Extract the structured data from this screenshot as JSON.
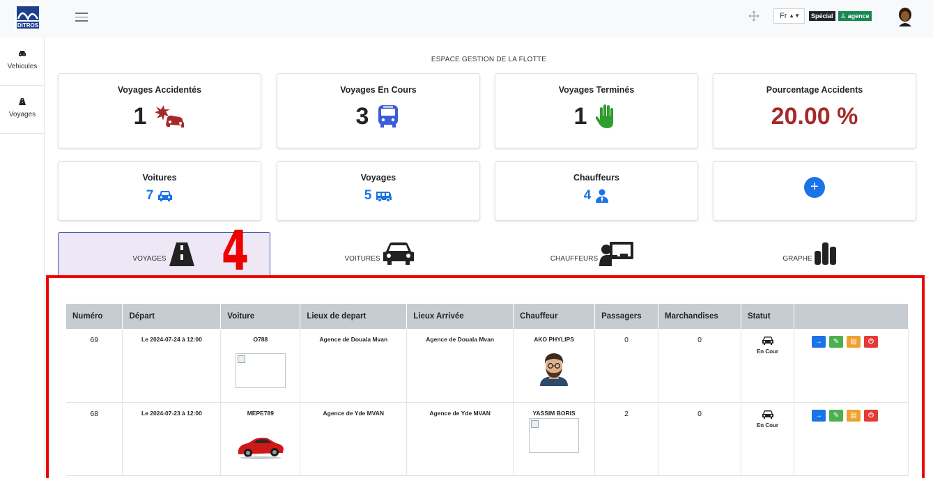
{
  "header": {
    "logo_text": "DITROS",
    "lang": "Fr",
    "badge_special": "Spécial",
    "badge_agence": "agence"
  },
  "sidebar": {
    "items": [
      {
        "label": "Vehicules",
        "icon": "car-icon"
      },
      {
        "label": "Voyages",
        "icon": "road-icon"
      }
    ]
  },
  "main": {
    "title": "ESPACE GESTION DE LA FLOTTE",
    "stats_top": [
      {
        "title": "Voyages Accidentés",
        "value": "1",
        "icon": "car-crash-icon",
        "color": "#a52a2a"
      },
      {
        "title": "Voyages En Cours",
        "value": "3",
        "icon": "bus-icon",
        "color": "#3b5bdb"
      },
      {
        "title": "Voyages Terminés",
        "value": "1",
        "icon": "hand-stop-icon",
        "color": "#2e9e2e"
      },
      {
        "title": "Pourcentage Accidents",
        "value": "20.00 %"
      }
    ],
    "stats_bottom": [
      {
        "title": "Voitures",
        "value": "7",
        "icon": "car-icon"
      },
      {
        "title": "Voyages",
        "value": "5",
        "icon": "shuttle-van-icon"
      },
      {
        "title": "Chauffeurs",
        "value": "4",
        "icon": "user-tie-icon"
      },
      {
        "title": "",
        "value": "+",
        "icon": "plus-icon"
      }
    ],
    "tabs": [
      {
        "label": "VOYAGES",
        "icon": "road-icon",
        "active": true
      },
      {
        "label": "VOITURES",
        "icon": "car-icon",
        "active": false
      },
      {
        "label": "CHAUFFEURS",
        "icon": "chalkboard-teacher-icon",
        "active": false
      },
      {
        "label": "GRAPHE",
        "icon": "bar-chart-icon",
        "active": false
      }
    ],
    "annotation": "4"
  },
  "table": {
    "columns": [
      "Numéro",
      "Départ",
      "Voiture",
      "Lieux de depart",
      "Lieux Arrivée",
      "Chauffeur",
      "Passagers",
      "Marchandises",
      "Statut",
      ""
    ],
    "rows": [
      {
        "numero": "69",
        "depart": "Le 2024-07-24 à 12:00",
        "voiture": "O788",
        "lieu_depart": "Agence de Douala Mvan",
        "lieu_arrivee": "Agence de Douala Mvan",
        "chauffeur": "AKO PHYLIPS",
        "passagers": "0",
        "marchandises": "0",
        "statut": "En Cour"
      },
      {
        "numero": "68",
        "depart": "Le 2024-07-23 à 12:00",
        "voiture": "MEPE789",
        "lieu_depart": "Agence de Yde MVAN",
        "lieu_arrivee": "Agence de Yde MVAN",
        "chauffeur": "YASSIM BORIS",
        "passagers": "2",
        "marchandises": "0",
        "statut": "En Cour"
      }
    ]
  },
  "colors": {
    "accent": "#1a73e8",
    "danger": "#a52a2a",
    "frame": "#ee0000",
    "header_bg": "#c7ccd3"
  }
}
